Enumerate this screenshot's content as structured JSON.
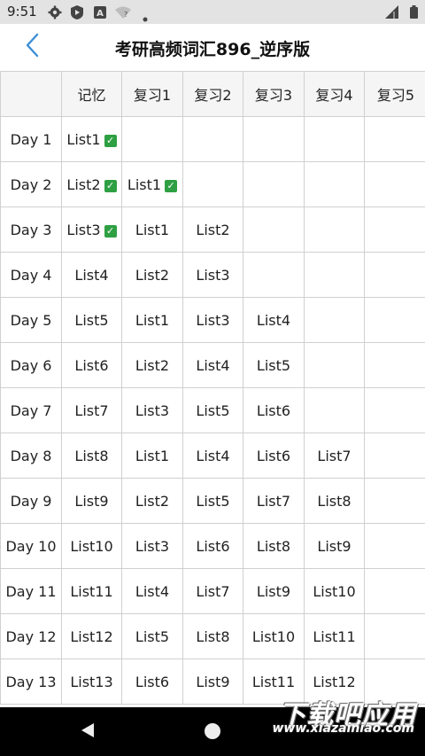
{
  "status_bar": {
    "time": "9:51",
    "icons": [
      "gear-icon",
      "shield-play-icon",
      "a-badge-icon",
      "wifi-question-icon",
      "dot-icon",
      "signal-icon",
      "battery-icon"
    ]
  },
  "app_bar": {
    "title": "考研高频词汇896_逆序版",
    "back_icon": "chevron-left-icon",
    "accent": "#3a8fd6"
  },
  "table": {
    "headers": [
      "",
      "记忆",
      "复习1",
      "复习2",
      "复习3",
      "复习4",
      "复习5"
    ],
    "rows": [
      {
        "day": "Day 1",
        "cells": [
          "List1 ✓",
          "",
          "",
          "",
          "",
          ""
        ]
      },
      {
        "day": "Day 2",
        "cells": [
          "List2 ✓",
          "List1 ✓",
          "",
          "",
          "",
          ""
        ]
      },
      {
        "day": "Day 3",
        "cells": [
          "List3 ✓",
          "List1",
          "List2",
          "",
          "",
          ""
        ]
      },
      {
        "day": "Day 4",
        "cells": [
          "List4",
          "List2",
          "List3",
          "",
          "",
          ""
        ]
      },
      {
        "day": "Day 5",
        "cells": [
          "List5",
          "List1",
          "List3",
          "List4",
          "",
          ""
        ]
      },
      {
        "day": "Day 6",
        "cells": [
          "List6",
          "List2",
          "List4",
          "List5",
          "",
          ""
        ]
      },
      {
        "day": "Day 7",
        "cells": [
          "List7",
          "List3",
          "List5",
          "List6",
          "",
          ""
        ]
      },
      {
        "day": "Day 8",
        "cells": [
          "List8",
          "List1",
          "List4",
          "List6",
          "List7",
          ""
        ]
      },
      {
        "day": "Day 9",
        "cells": [
          "List9",
          "List2",
          "List5",
          "List7",
          "List8",
          ""
        ]
      },
      {
        "day": "Day 10",
        "cells": [
          "List10",
          "List3",
          "List6",
          "List8",
          "List9",
          ""
        ]
      },
      {
        "day": "Day 11",
        "cells": [
          "List11",
          "List4",
          "List7",
          "List9",
          "List10",
          ""
        ]
      },
      {
        "day": "Day 12",
        "cells": [
          "List12",
          "List5",
          "List8",
          "List10",
          "List11",
          ""
        ]
      },
      {
        "day": "Day 13",
        "cells": [
          "List13",
          "List6",
          "List9",
          "List11",
          "List12",
          ""
        ]
      }
    ]
  },
  "watermark": {
    "title": "下载吧应用",
    "url": "www.xiazainiao.com"
  },
  "colors": {
    "status_bar_bg": "#e3e3e3",
    "grid_line": "#d0d0d0",
    "header_bg": "#f5f5f5",
    "check_green": "#2ea043",
    "nav_bar_bg": "#000000"
  }
}
